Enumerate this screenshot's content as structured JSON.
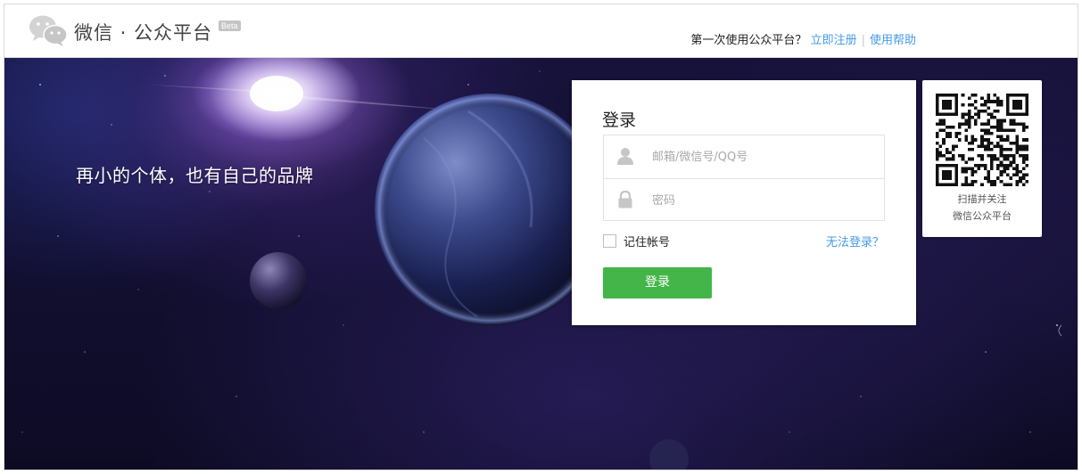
{
  "header": {
    "logo_text": "微信 · 公众平台",
    "beta_label": "Beta",
    "question": "第一次使用公众平台？",
    "register_link": "立即注册",
    "separator": "|",
    "help_link": "使用帮助"
  },
  "hero": {
    "slogan": "再小的个体，也有自己的品牌"
  },
  "login": {
    "title": "登录",
    "account_placeholder": "邮箱/微信号/QQ号",
    "account_value": "",
    "password_placeholder": "密码",
    "password_value": "",
    "remember_label": "记住帐号",
    "remember_checked": false,
    "forgot_link": "无法登录？",
    "submit_label": "登录",
    "accent_color": "#44b549",
    "link_color": "#459ae9"
  },
  "qr": {
    "caption_line1": "扫描并关注",
    "caption_line2": "微信公众平台"
  },
  "icons": {
    "logo": "wechat-logo-icon",
    "user": "user-icon",
    "lock": "lock-icon",
    "qr": "qr-code-icon"
  }
}
